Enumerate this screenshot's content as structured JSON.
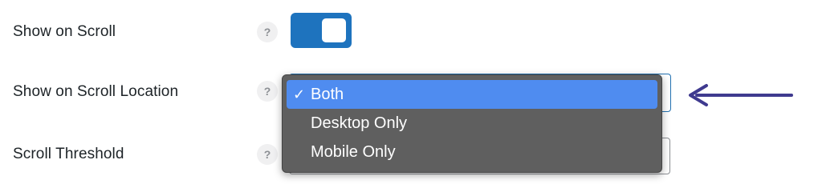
{
  "rows": {
    "show_on_scroll": {
      "label": "Show on Scroll",
      "help": "?",
      "toggle_on": true
    },
    "scroll_location": {
      "label": "Show on Scroll Location",
      "help": "?"
    },
    "scroll_threshold": {
      "label": "Scroll Threshold",
      "help": "?"
    }
  },
  "dropdown": {
    "selected_value": "Both",
    "check_glyph": "✓",
    "options": [
      {
        "label": "Both",
        "selected": true
      },
      {
        "label": "Desktop Only",
        "selected": false
      },
      {
        "label": "Mobile Only",
        "selected": false
      }
    ]
  },
  "colors": {
    "toggle_on": "#1e73be",
    "menu_bg": "#5f5f5f",
    "menu_highlight": "#4f8cf0",
    "arrow": "#3f3a8f"
  },
  "icons": {
    "help": "question-mark-icon",
    "check": "checkmark-icon",
    "pointer": "left-arrow-icon"
  }
}
